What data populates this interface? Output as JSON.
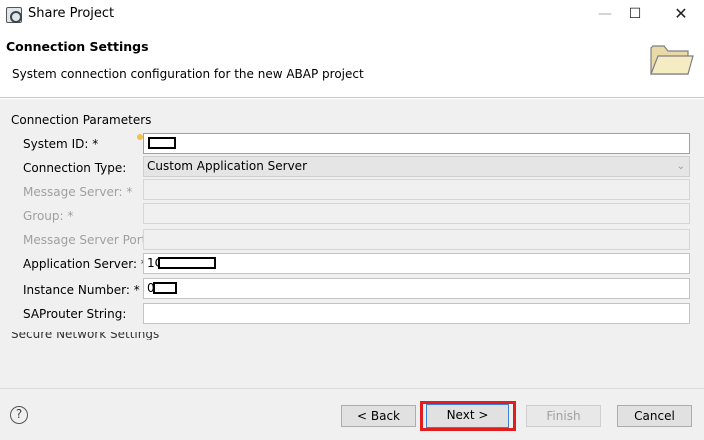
{
  "window": {
    "title": "Share Project",
    "minimize": "—",
    "maximize": "☐",
    "close": "✕"
  },
  "header": {
    "title": "Connection Settings",
    "description": "System connection configuration for the new ABAP project",
    "icon": "folder-icon"
  },
  "group": {
    "label": "Connection Parameters",
    "next_group_label": "Secure Network Settings"
  },
  "fields": {
    "system_id": {
      "label": "System ID: *",
      "value": ""
    },
    "connection_type": {
      "label": "Connection Type:",
      "value": "Custom Application Server"
    },
    "message_server": {
      "label": "Message Server: *",
      "value": ""
    },
    "group": {
      "label": "Group: *",
      "value": ""
    },
    "message_server_port": {
      "label": "Message Server Port:",
      "value": ""
    },
    "application_server": {
      "label": "Application Server: *",
      "value": "1C"
    },
    "instance_number": {
      "label": "Instance Number: *",
      "value": "0"
    },
    "saprouter_string": {
      "label": "SAProuter String:",
      "value": ""
    }
  },
  "footer": {
    "help": "?",
    "back": "< Back",
    "next": "Next >",
    "finish": "Finish",
    "cancel": "Cancel"
  }
}
